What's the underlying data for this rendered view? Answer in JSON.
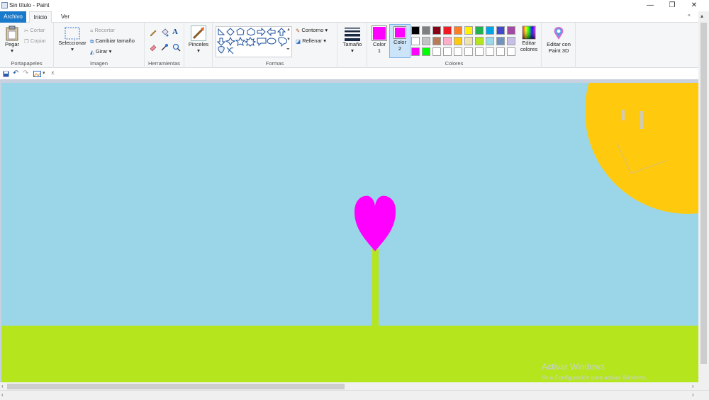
{
  "window": {
    "title": "Sin título - Paint",
    "minimize": "—",
    "restore": "❐",
    "close": "✕"
  },
  "tabs": {
    "file": "Archivo",
    "home": "Inicio",
    "view": "Ver",
    "collapse": "^"
  },
  "clipboard": {
    "paste": "Pegar",
    "cut": "Cortar",
    "copy": "Copiar",
    "label": "Portapapeles"
  },
  "image": {
    "select": "Seleccionar",
    "crop": "Recortar",
    "resize": "Cambiar tamaño",
    "rotate": "Girar",
    "label": "Imagen"
  },
  "tools": {
    "label": "Herramientas"
  },
  "brushes": {
    "label": "Pinceles"
  },
  "shapes": {
    "outline": "Contorno",
    "fill": "Rellenar",
    "label": "Formas"
  },
  "size": {
    "label": "Tamaño"
  },
  "colors": {
    "color1": "Color",
    "color1_num": "1",
    "color2": "Color",
    "color2_num": "2",
    "color1_value": "#ff00ff",
    "color2_value": "#ff00ff",
    "edit": "Editar",
    "edit2": "colores",
    "label": "Colores",
    "palette_row1": [
      "#000000",
      "#7f7f7f",
      "#880015",
      "#ed1c24",
      "#ff7f27",
      "#fff200",
      "#22b14c",
      "#00a2e8",
      "#3f48cc",
      "#a349a4"
    ],
    "palette_row2": [
      "#ffffff",
      "#c3c3c3",
      "#b97a57",
      "#ffaec9",
      "#ffc90e",
      "#efe4b0",
      "#b5e61d",
      "#99d9ea",
      "#7092be",
      "#c8bfe7"
    ],
    "palette_row3": [
      "#ff00ff",
      "#00ff00",
      "#ffffff",
      "#ffffff",
      "#ffffff",
      "#ffffff",
      "#ffffff",
      "#ffffff",
      "#ffffff",
      "#ffffff"
    ]
  },
  "paint3d": {
    "line1": "Editar con",
    "line2": "Paint 3D"
  },
  "watermark": {
    "line1": "Activar Windows",
    "line2": "Ve a Configuración para activar Windows."
  }
}
